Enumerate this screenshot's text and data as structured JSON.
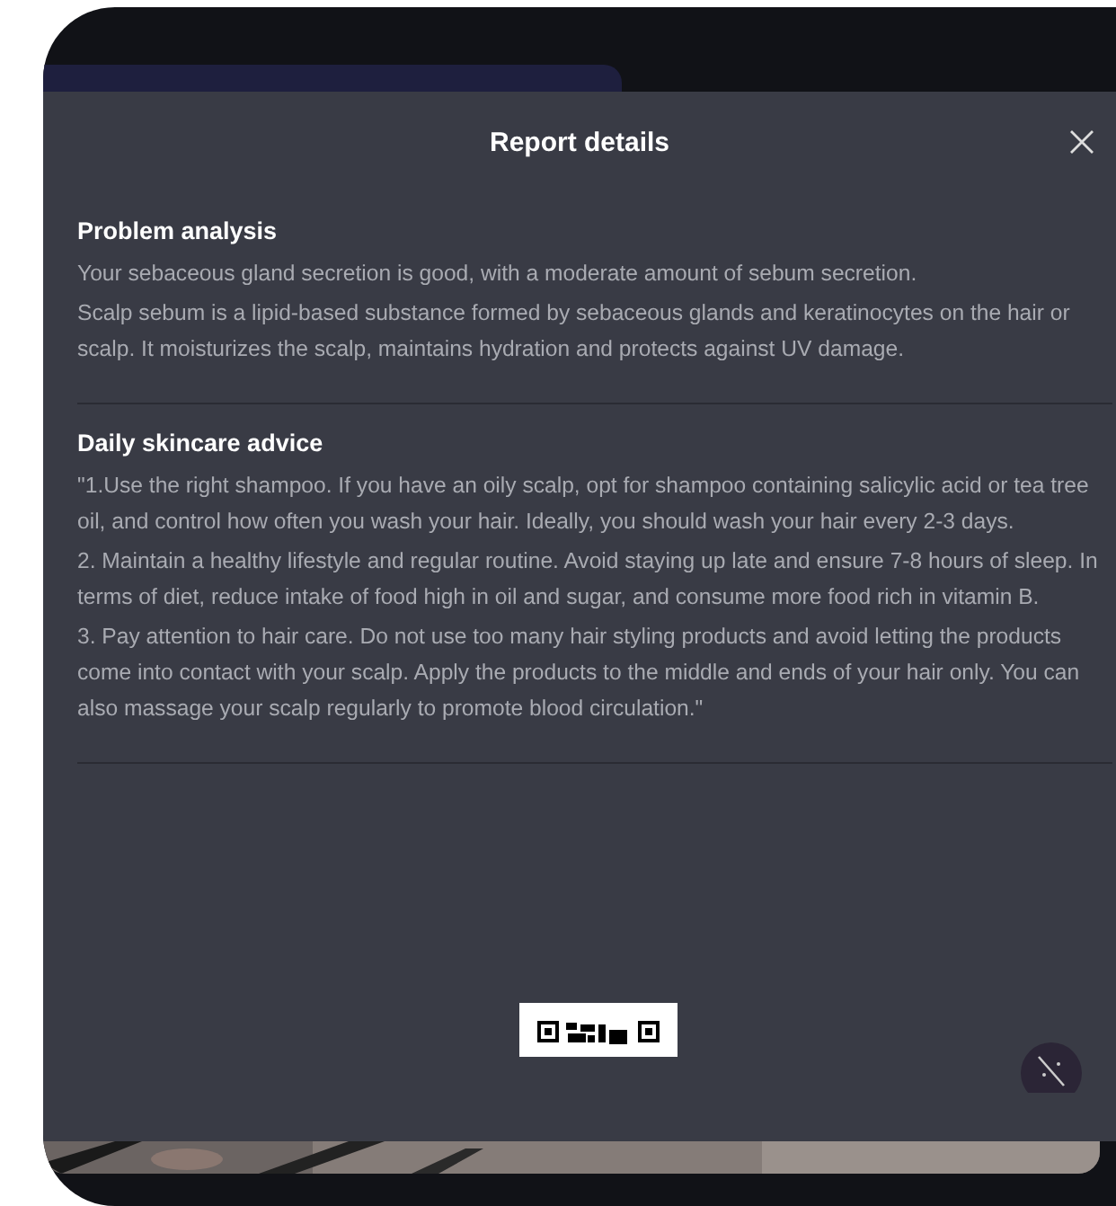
{
  "dialog": {
    "title": "Report details",
    "sections": [
      {
        "heading": "Problem analysis",
        "paragraphs": [
          "Your sebaceous gland secretion is good, with a moderate amount of sebum secretion.",
          "Scalp sebum is a lipid-based substance formed by sebaceous glands and keratinocytes on the hair or scalp. It moisturizes the scalp, maintains hydration and protects against UV damage."
        ]
      },
      {
        "heading": "Daily skincare advice",
        "paragraphs": [
          "\"1.Use the right shampoo. If you have an oily scalp, opt for shampoo containing salicylic acid or tea tree oil, and control how often you wash your hair. Ideally, you should wash your hair every 2-3 days.",
          "2. Maintain a healthy lifestyle and regular routine. Avoid staying up late and ensure 7-8 hours of sleep. In terms of diet, reduce intake of food high in oil and sugar, and consume more food rich in vitamin B.",
          "3. Pay attention to hair care. Do not use too many hair styling products and avoid letting the products come into contact with your scalp. Apply the products to the middle and ends of your hair only. You can also massage your scalp regularly to promote blood circulation.\""
        ]
      }
    ]
  }
}
